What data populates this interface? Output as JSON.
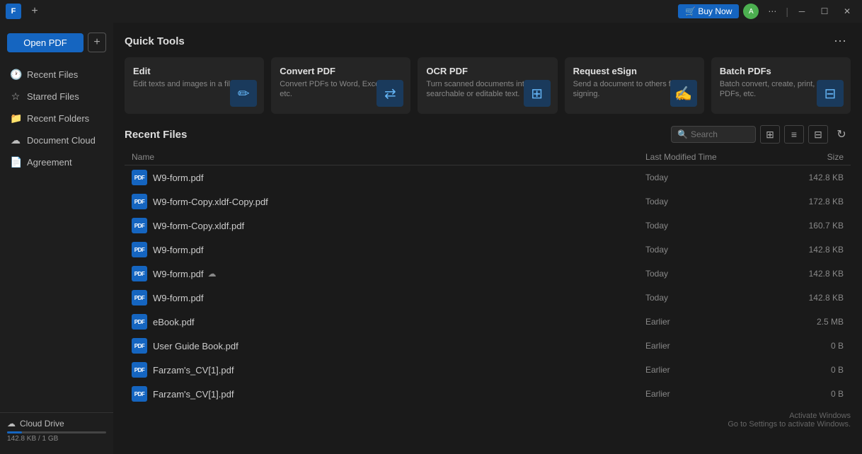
{
  "titlebar": {
    "app_label": "F",
    "new_tab_label": "+",
    "buy_now_label": "🛒 Buy Now",
    "avatar_label": "A",
    "ellipsis": "⋯",
    "minimize": "─",
    "maximize": "☐",
    "close": "✕"
  },
  "sidebar": {
    "open_pdf_label": "Open PDF",
    "add_label": "+",
    "nav_items": [
      {
        "id": "recent-files",
        "icon": "🕐",
        "label": "Recent Files"
      },
      {
        "id": "starred-files",
        "icon": "☆",
        "label": "Starred Files"
      },
      {
        "id": "recent-folders",
        "icon": "📁",
        "label": "Recent Folders"
      },
      {
        "id": "document-cloud",
        "icon": "☁",
        "label": "Document Cloud"
      },
      {
        "id": "agreement",
        "icon": "📄",
        "label": "Agreement"
      }
    ],
    "cloud_drive_label": "Cloud Drive",
    "storage_used": "142.8 KB / 1 GB"
  },
  "quick_tools": {
    "title": "Quick Tools",
    "more_icon": "⋯",
    "tools": [
      {
        "id": "edit",
        "title": "Edit",
        "desc": "Edit texts and images in a file.",
        "icon": "✏"
      },
      {
        "id": "convert-pdf",
        "title": "Convert PDF",
        "desc": "Convert PDFs to Word, Excel, PPT, etc.",
        "icon": "⇄"
      },
      {
        "id": "ocr-pdf",
        "title": "OCR PDF",
        "desc": "Turn scanned documents into searchable or editable text.",
        "icon": "⊞"
      },
      {
        "id": "request-esign",
        "title": "Request eSign",
        "desc": "Send a document to others for signing.",
        "icon": "✍"
      },
      {
        "id": "batch-pdfs",
        "title": "Batch PDFs",
        "desc": "Batch convert, create, print, OCR PDFs, etc.",
        "icon": "⊟"
      }
    ]
  },
  "recent_files": {
    "title": "Recent Files",
    "search_placeholder": "Search",
    "columns": {
      "name": "Name",
      "modified": "Last Modified Time",
      "size": "Size"
    },
    "files": [
      {
        "name": "W9-form.pdf",
        "modified": "Today",
        "size": "142.8 KB",
        "cloud": false
      },
      {
        "name": "W9-form-Copy.xldf-Copy.pdf",
        "modified": "Today",
        "size": "172.8 KB",
        "cloud": false
      },
      {
        "name": "W9-form-Copy.xldf.pdf",
        "modified": "Today",
        "size": "160.7 KB",
        "cloud": false
      },
      {
        "name": "W9-form.pdf",
        "modified": "Today",
        "size": "142.8 KB",
        "cloud": false
      },
      {
        "name": "W9-form.pdf",
        "modified": "Today",
        "size": "142.8 KB",
        "cloud": true
      },
      {
        "name": "W9-form.pdf",
        "modified": "Today",
        "size": "142.8 KB",
        "cloud": false
      },
      {
        "name": "eBook.pdf",
        "modified": "Earlier",
        "size": "2.5 MB",
        "cloud": false
      },
      {
        "name": "User Guide Book.pdf",
        "modified": "Earlier",
        "size": "0 B",
        "cloud": false
      },
      {
        "name": "Farzam's_CV[1].pdf",
        "modified": "Earlier",
        "size": "0 B",
        "cloud": false
      },
      {
        "name": "Farzam's_CV[1].pdf",
        "modified": "Earlier",
        "size": "0 B",
        "cloud": false
      }
    ]
  },
  "activation": {
    "title": "Activate Windows",
    "desc": "Go to Settings to activate Windows."
  }
}
